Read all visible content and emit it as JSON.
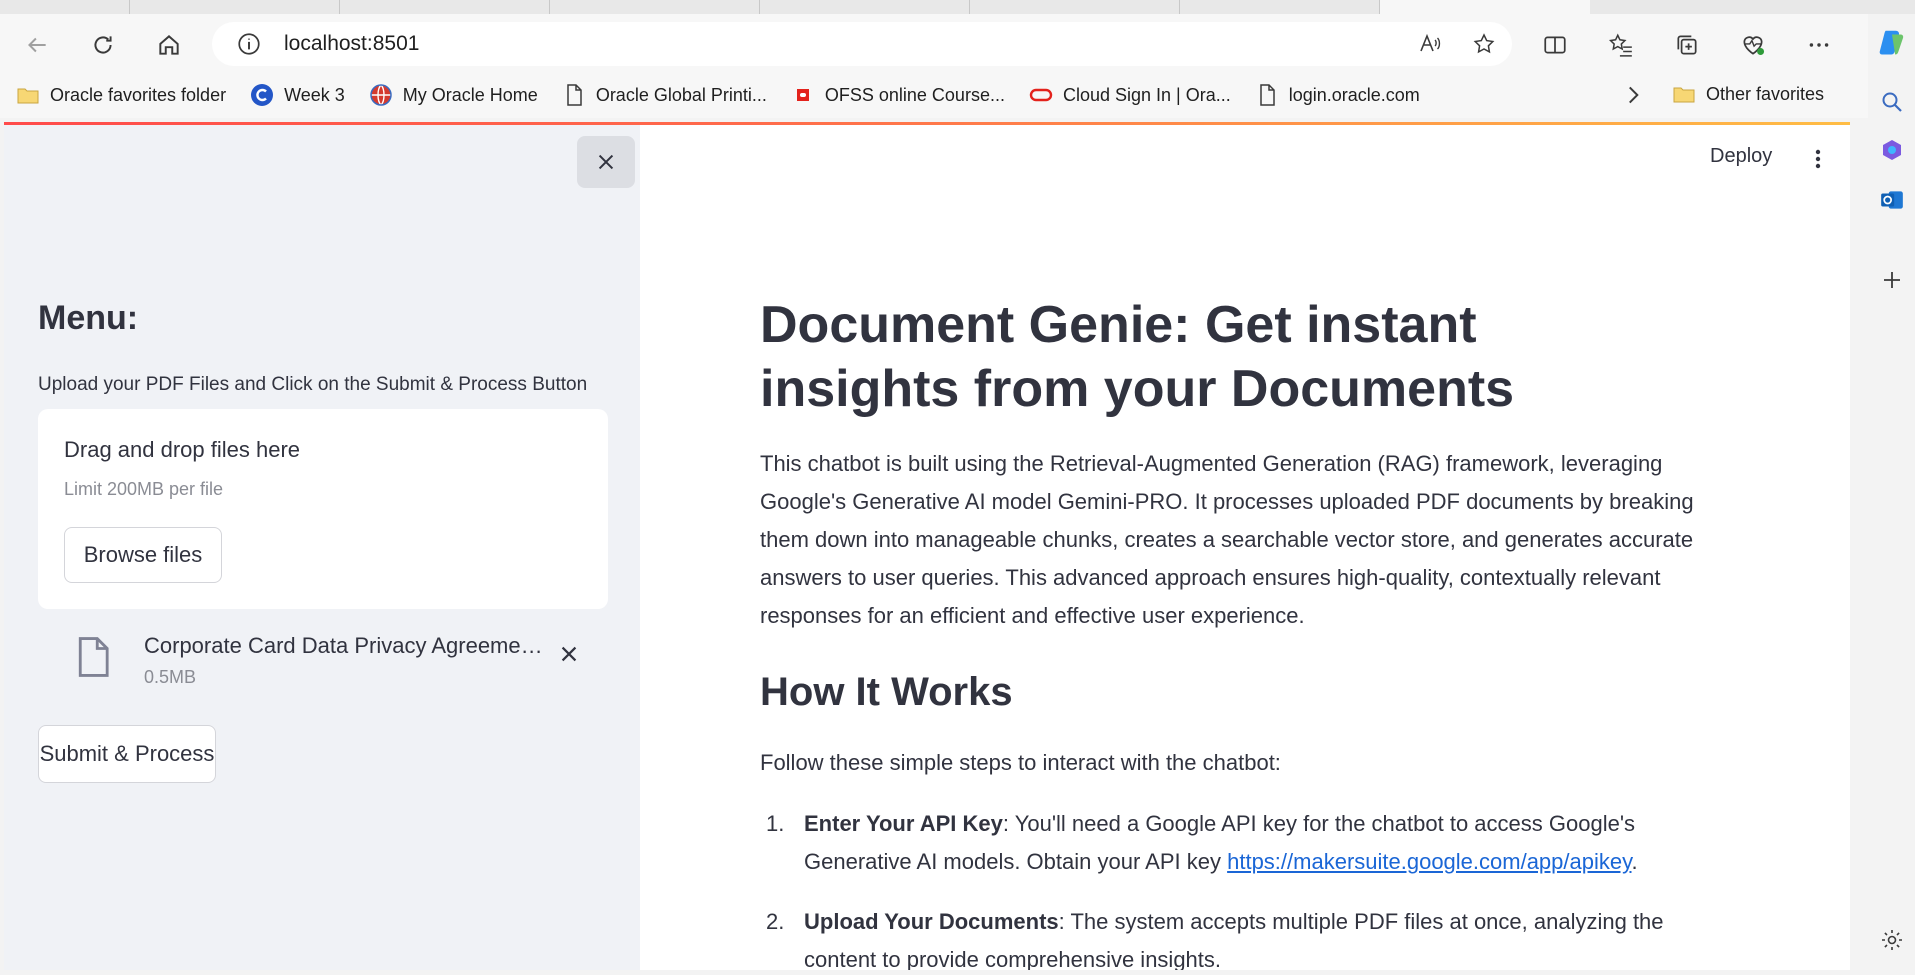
{
  "browser": {
    "url": "localhost:8501",
    "bookmarks": [
      {
        "label": "Oracle favorites folder",
        "icon": "folder-icon"
      },
      {
        "label": "Week 3",
        "icon": "c-logo-icon"
      },
      {
        "label": "My Oracle Home",
        "icon": "globe-logo-icon"
      },
      {
        "label": "Oracle Global Printi...",
        "icon": "page-icon"
      },
      {
        "label": "OFSS online Course...",
        "icon": "red-square-icon"
      },
      {
        "label": "Cloud Sign In | Ora...",
        "icon": "oracle-ring-icon"
      },
      {
        "label": "login.oracle.com",
        "icon": "page-icon"
      }
    ],
    "other_favorites": "Other favorites"
  },
  "sidebar": {
    "menu_title": "Menu:",
    "menu_subtitle": "Upload your PDF Files and Click on the Submit & Process Button",
    "dropzone": {
      "title": "Drag and drop files here",
      "limit": "Limit 200MB per file",
      "browse_label": "Browse files"
    },
    "file": {
      "name": "Corporate Card Data Privacy Agreement.pdf",
      "size": "0.5MB"
    },
    "submit_label": "Submit & Process"
  },
  "main": {
    "deploy_label": "Deploy",
    "title": "Document Genie: Get instant insights from your Documents",
    "intro": "This chatbot is built using the Retrieval-Augmented Generation (RAG) framework, leveraging Google's Generative AI model Gemini-PRO. It processes uploaded PDF documents by breaking them down into manageable chunks, creates a searchable vector store, and generates accurate answers to user queries. This advanced approach ensures high-quality, contextually relevant responses for an efficient and effective user experience.",
    "how_title": "How It Works",
    "follow_text": "Follow these simple steps to interact with the chatbot:",
    "steps": [
      {
        "num": "1.",
        "bold": "Enter Your API Key",
        "text": ": You'll need a Google API key for the chatbot to access Google's Generative AI models. Obtain your API key ",
        "link": "https://makersuite.google.com/app/apikey",
        "after": "."
      },
      {
        "num": "2.",
        "bold": "Upload Your Documents",
        "text": ": The system accepts multiple PDF files at once, analyzing the content to provide comprehensive insights."
      }
    ]
  },
  "colors": {
    "sidebar_bg": "#f0f2f6",
    "text": "#31333f",
    "link": "#1a66d6",
    "accent_gradient_start": "#ff4b4b",
    "accent_gradient_end": "#ffbd45"
  }
}
